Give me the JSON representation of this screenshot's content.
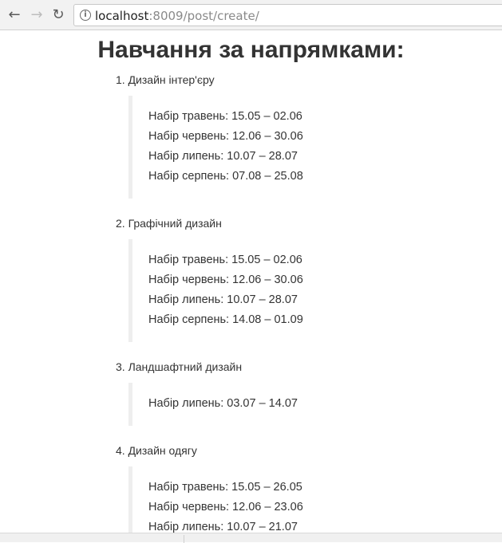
{
  "browser": {
    "url_host": "localhost",
    "url_rest": ":8009/post/create/"
  },
  "page": {
    "title": "Навчання за напрямками:",
    "courses": [
      {
        "label": "1. Дизайн інтер'єру",
        "lines": [
          "Набір травень: 15.05 – 02.06",
          "Набір червень: 12.06 – 30.06",
          "Набір липень: 10.07 – 28.07",
          "Набір серпень: 07.08 – 25.08"
        ]
      },
      {
        "label": "2. Графічний дизайн",
        "lines": [
          "Набір травень: 15.05 – 02.06",
          "Набір червень: 12.06 – 30.06",
          "Набір липень: 10.07 – 28.07",
          "Набір серпень: 14.08 – 01.09"
        ]
      },
      {
        "label": "3. Ландшафтний дизайн",
        "lines": [
          "Набір липень: 03.07 – 14.07"
        ]
      },
      {
        "label": "4. Дизайн одягу",
        "lines": [
          "Набір травень: 15.05 – 26.05",
          "Набір червень: 12.06 – 23.06",
          "Набір липень: 10.07 – 21.07"
        ]
      }
    ]
  }
}
